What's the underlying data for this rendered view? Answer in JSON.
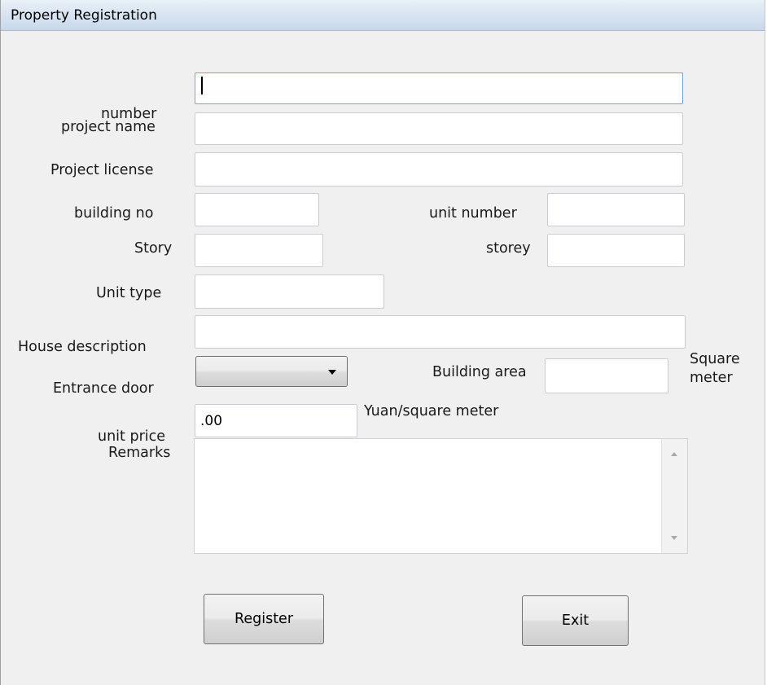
{
  "window": {
    "title": "Property Registration"
  },
  "form": {
    "number_label": "number",
    "number_value": "",
    "project_name_label": "project name",
    "project_name_value": "",
    "project_license_label": "Project license",
    "project_license_value": "",
    "building_no_label": "building no",
    "building_no_value": "",
    "unit_number_label": "unit number",
    "unit_number_value": "",
    "story_label": "Story",
    "story_value": "",
    "storey_label": "storey",
    "storey_value": "",
    "unit_type_label": "Unit type",
    "unit_type_value": "",
    "house_description_label": "House description",
    "house_description_value": "",
    "entrance_door_label": "Entrance door",
    "entrance_door_value": "",
    "building_area_label": "Building area",
    "building_area_value": "",
    "building_area_unit_line1": "Square",
    "building_area_unit_line2": "meter",
    "unit_price_label": "unit price",
    "unit_price_value": ".00",
    "unit_price_unit": "Yuan/square meter",
    "remarks_label": "Remarks",
    "remarks_value": ""
  },
  "buttons": {
    "register_label": "Register",
    "exit_label": "Exit"
  },
  "colors": {
    "window_bg": "#f0f0f0",
    "focused_border": "#7da2ce",
    "field_border": "#c9cdd2"
  }
}
